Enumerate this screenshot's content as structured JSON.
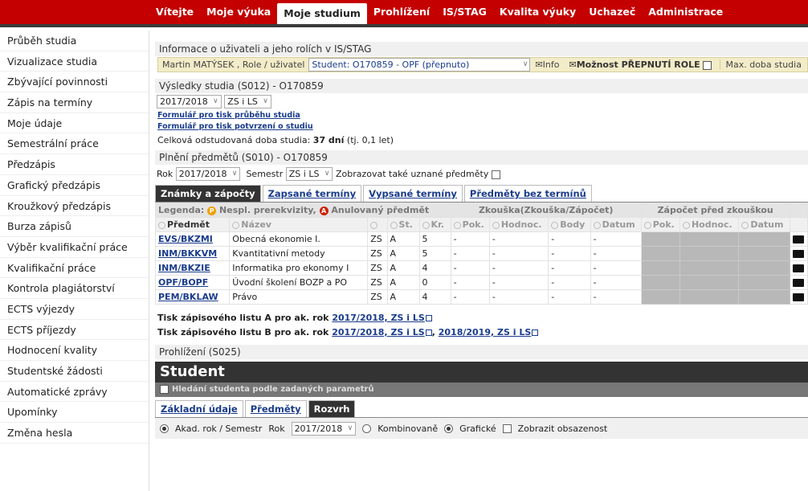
{
  "topnav": {
    "items": [
      "Vítejte",
      "Moje výuka",
      "Moje studium",
      "Prohlížení",
      "IS/STAG",
      "Kvalita výuky",
      "Uchazeč",
      "Administrace"
    ],
    "active_index": 2
  },
  "sidebar": {
    "items": [
      "Průběh studia",
      "Vizualizace studia",
      "Zbývající povinnosti",
      "Zápis na termíny",
      "Moje údaje",
      "Semestrální práce",
      "Předzápis",
      "Grafický předzápis",
      "Kroužkový předzápis",
      "Burza zápisů",
      "Výběr kvalifikační práce",
      "Kvalifikační práce",
      "Kontrola plagiátorství",
      "ECTS výjezdy",
      "ECTS příjezdy",
      "Hodnocení kvality",
      "Studentské žádosti",
      "Automatické zprávy",
      "Upomínky",
      "Změna hesla"
    ]
  },
  "userinfo": {
    "title": "Informace o uživateli a jeho rolích v IS/STAG",
    "user": "Martin MATÝSEK , Role / uživatel",
    "role_value": "Student: O170859 - OPF (přepnuto)",
    "info_label": "Info",
    "switch_label": "Možnost PŘEPNUTÍ ROLE",
    "max_label": "Max. doba studia"
  },
  "results": {
    "title": "Výsledky studia (S012) - O170859",
    "year_value": "2017/2018",
    "semester_value": "ZS i LS",
    "link1": "Formulář pro tisk průběhu studia",
    "link2": "Formulář pro tisk potvrzení o studiu",
    "duration_label": "Celková odstudovaná doba studia:",
    "duration_value": "37 dní",
    "duration_note": "(tj. 0,1 let)"
  },
  "subjects": {
    "title": "Plnění předmětů (S010) - O170859",
    "rok_label": "Rok",
    "rok_value": "2017/2018",
    "semestr_label": "Semestr",
    "semestr_value": "ZS i LS",
    "show_recognized": "Zobrazovat také uznané předměty",
    "tabs": [
      "Známky a zápočty",
      "Zapsané termíny",
      "Vypsané termíny",
      "Předměty bez termínů"
    ],
    "legend_label": "Legenda:",
    "legend_p": "Nespl. prerekvizity,",
    "legend_a": "Anulovaný předmět",
    "group_exam": "Zkouška(Zkouška/Zápočet)",
    "group_credit": "Zápočet před zkouškou",
    "columns": [
      "Předmět",
      "Název",
      "",
      "St.",
      "Kr.",
      "Pok.",
      "Hodnoc.",
      "Body",
      "Datum",
      "Pok.",
      "Hodnoc.",
      "Datum"
    ],
    "rows": [
      {
        "code": "EVS/BKZMI",
        "name": "Obecná ekonomie I.",
        "sem": "ZS",
        "st": "A",
        "kr": "5",
        "pok": "-",
        "hodn": "-",
        "body": "-",
        "datum": "-"
      },
      {
        "code": "INM/BKKVM",
        "name": "Kvantitativní metody",
        "sem": "ZS",
        "st": "A",
        "kr": "5",
        "pok": "-",
        "hodn": "-",
        "body": "-",
        "datum": "-"
      },
      {
        "code": "INM/BKZIE",
        "name": "Informatika pro ekonomy I",
        "sem": "ZS",
        "st": "A",
        "kr": "4",
        "pok": "-",
        "hodn": "-",
        "body": "-",
        "datum": "-"
      },
      {
        "code": "OPF/BOPF",
        "name": "Úvodní školení BOZP a PO",
        "sem": "ZS",
        "st": "A",
        "kr": "0",
        "pok": "-",
        "hodn": "-",
        "body": "-",
        "datum": "-"
      },
      {
        "code": "PEM/BKLAW",
        "name": "Právo",
        "sem": "ZS",
        "st": "A",
        "kr": "4",
        "pok": "-",
        "hodn": "-",
        "body": "-",
        "datum": "-"
      }
    ],
    "print_a_label": "Tisk zápisového listu A pro ak. rok",
    "print_a_link": "2017/2018, ZS i LS",
    "print_b_label": "Tisk zápisového listu B pro ak. rok",
    "print_b_link1": "2017/2018, ZS i LS",
    "print_b_link2": "2018/2019, ZS i LS"
  },
  "student": {
    "section_title": "Prohlížení (S025)",
    "header": "Student",
    "search_label": "Hledání studenta podle zadaných parametrů",
    "tabs": [
      "Základní údaje",
      "Předměty",
      "Rozvrh"
    ],
    "mode_label": "Akad. rok / Semestr",
    "rok_label": "Rok",
    "rok_value": "2017/2018",
    "opt_combined": "Kombinovaně",
    "opt_graphic": "Grafické",
    "chk_occupancy": "Zobrazit obsazenost"
  }
}
